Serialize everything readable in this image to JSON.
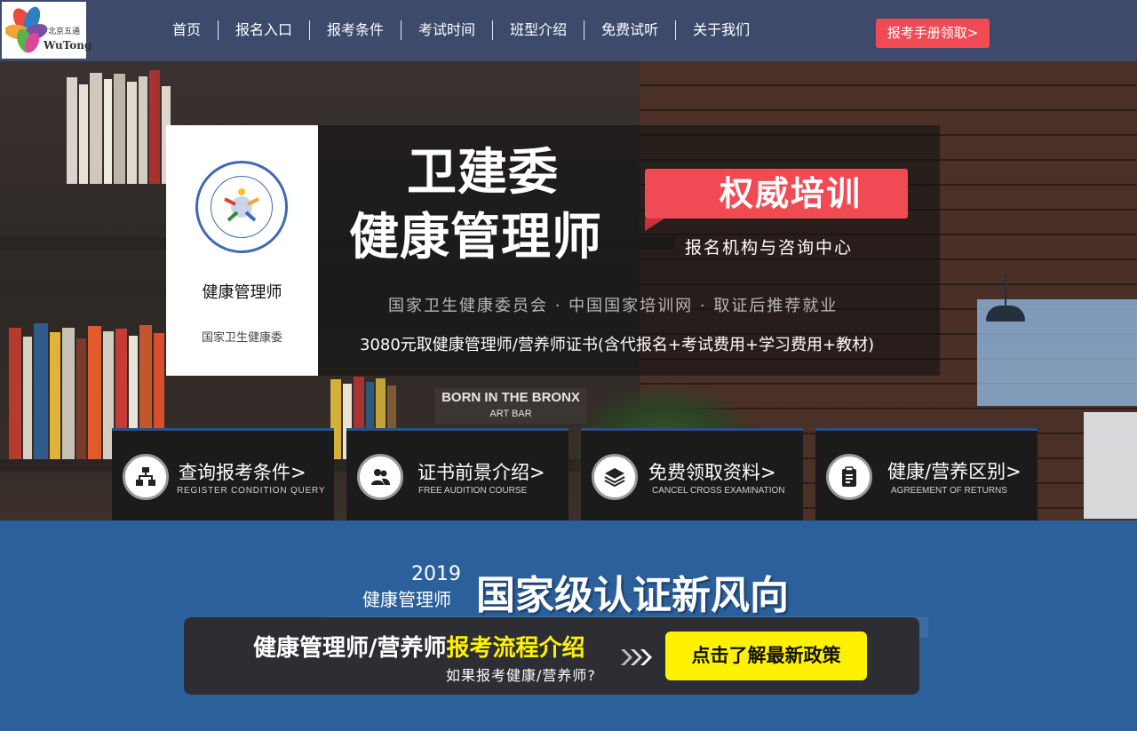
{
  "header": {
    "logo": {
      "cn_text": "北京五通",
      "en_text": "WuTong"
    },
    "nav": [
      {
        "label": "首页"
      },
      {
        "label": "报名入口"
      },
      {
        "label": "报考条件"
      },
      {
        "label": "考试时间"
      },
      {
        "label": "班型介绍"
      },
      {
        "label": "免费试听"
      },
      {
        "label": "关于我们"
      }
    ],
    "cta_label": "报考手册领取>",
    "cta_color": "#f04a55"
  },
  "hero": {
    "card": {
      "title": "健康管理师",
      "subtitle": "国家卫生健康委",
      "seal_icon": "organization-seal-icon"
    },
    "title_line1": "卫建委",
    "title_line2": "健康管理师",
    "ribbon": "权威培训",
    "tagline": "报名机构与咨询中心",
    "features": "国家卫生健康委员会 · 中国国家培训网 · 取证后推荐就业",
    "price": "3080元取健康管理师/营养师证书(含代报名+考试费用+学习费用+教材)",
    "background_book": {
      "line1": "BORN IN THE BRONX",
      "line2": "ART BAR"
    }
  },
  "tiles": [
    {
      "title": "查询报考条件>",
      "subtitle": "REGISTER CONDITION QUERY",
      "icon": "org-chart-icon"
    },
    {
      "title": "证书前景介绍>",
      "subtitle": "FREE AUDITION COURSE",
      "icon": "users-icon"
    },
    {
      "title": "免费领取资料>",
      "subtitle": "CANCEL CROSS EXAMINATION",
      "icon": "layers-icon"
    },
    {
      "title": "健康/营养区别>",
      "subtitle": "AGREEMENT OF RETURNS",
      "icon": "clipboard-icon"
    }
  ],
  "banner": {
    "year": "2019",
    "year_sub": "健康管理师",
    "headline": "国家级认证新风向",
    "process_prefix": "健康管理师/营养师",
    "process_highlight": "报考流程介绍",
    "question": "如果报考健康/营养师?",
    "button": "点击了解最新政策",
    "accent_yellow": "#fff200",
    "section_color": "#2c609b"
  }
}
